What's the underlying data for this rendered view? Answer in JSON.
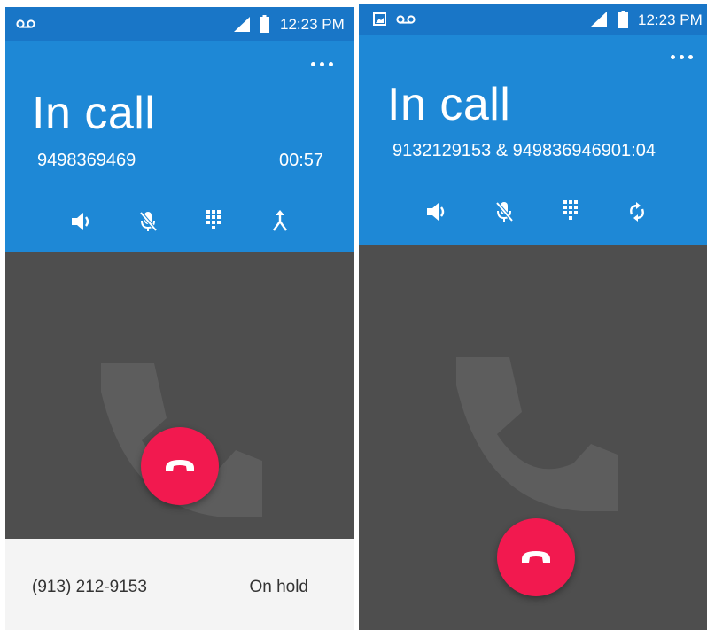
{
  "left_screen": {
    "status_bar": {
      "time": "12:23 PM",
      "icons": [
        "voicemail-icon",
        "signal-icon",
        "battery-icon"
      ]
    },
    "header": {
      "title": "In call",
      "number": "9498369469",
      "timer": "00:57",
      "menu_icon": "overflow-menu-icon"
    },
    "controls": [
      "speaker-icon",
      "mute-icon",
      "dialpad-icon",
      "merge-call-icon"
    ],
    "end_call_icon": "end-call-icon",
    "hold_bar": {
      "number": "(913) 212-9153",
      "status": "On hold"
    }
  },
  "right_screen": {
    "status_bar": {
      "time": "12:23 PM",
      "icons": [
        "image-icon",
        "voicemail-icon",
        "signal-icon",
        "battery-icon"
      ]
    },
    "header": {
      "title": "In call",
      "participants_and_timer": "9132129153 & 949836946901:04",
      "menu_icon": "overflow-menu-icon"
    },
    "controls": [
      "speaker-icon",
      "mute-icon",
      "dialpad-icon",
      "swap-call-icon"
    ],
    "end_call_icon": "end-call-icon"
  },
  "colors": {
    "status_bar": "#1976c7",
    "header": "#1e88d6",
    "body": "#4e4e4e",
    "end_call": "#f2194f",
    "hold_bar": "#f4f4f4"
  }
}
